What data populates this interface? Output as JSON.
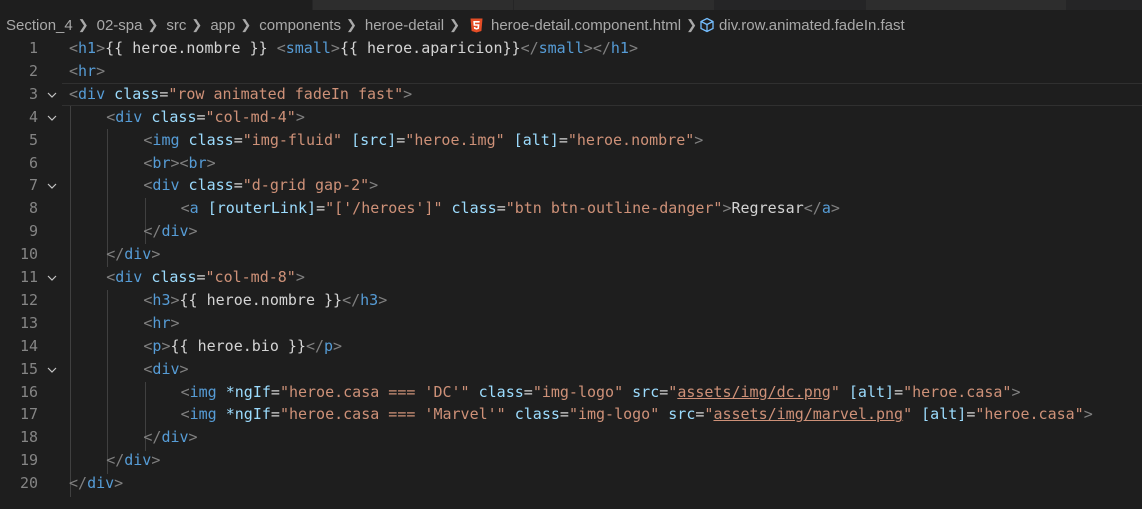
{
  "breadcrumb": {
    "items": [
      "Section_4",
      "02-spa",
      "src",
      "app",
      "components",
      "heroe-detail"
    ],
    "file": "heroe-detail.component.html",
    "symbol": "div.row.animated.fadeIn.fast"
  },
  "editor": {
    "current_line": 3,
    "lines": [
      {
        "n": "1",
        "fold": false,
        "indent": 0,
        "tokens": [
          {
            "t": "<",
            "c": "ptag"
          },
          {
            "t": "h1",
            "c": "tag"
          },
          {
            "t": ">",
            "c": "ptag"
          },
          {
            "t": "{{ heroe.nombre }} ",
            "c": "txt"
          },
          {
            "t": "<",
            "c": "ptag"
          },
          {
            "t": "small",
            "c": "tag"
          },
          {
            "t": ">",
            "c": "ptag"
          },
          {
            "t": "{{ heroe.aparicion}}",
            "c": "txt"
          },
          {
            "t": "</",
            "c": "ptag"
          },
          {
            "t": "small",
            "c": "tag"
          },
          {
            "t": ">",
            "c": "ptag"
          },
          {
            "t": "</",
            "c": "ptag"
          },
          {
            "t": "h1",
            "c": "tag"
          },
          {
            "t": ">",
            "c": "ptag"
          }
        ]
      },
      {
        "n": "2",
        "fold": false,
        "indent": 0,
        "tokens": [
          {
            "t": "<",
            "c": "ptag"
          },
          {
            "t": "hr",
            "c": "tag"
          },
          {
            "t": ">",
            "c": "ptag"
          }
        ]
      },
      {
        "n": "3",
        "fold": true,
        "indent": 0,
        "tokens": [
          {
            "t": "<",
            "c": "ptag"
          },
          {
            "t": "div",
            "c": "tag"
          },
          {
            "t": " ",
            "c": "txt"
          },
          {
            "t": "class",
            "c": "attr"
          },
          {
            "t": "=",
            "c": "txt"
          },
          {
            "t": "\"row animated fadeIn fast\"",
            "c": "str"
          },
          {
            "t": ">",
            "c": "ptag"
          }
        ]
      },
      {
        "n": "4",
        "fold": true,
        "indent": 1,
        "tokens": [
          {
            "t": "<",
            "c": "ptag"
          },
          {
            "t": "div",
            "c": "tag"
          },
          {
            "t": " ",
            "c": "txt"
          },
          {
            "t": "class",
            "c": "attr"
          },
          {
            "t": "=",
            "c": "txt"
          },
          {
            "t": "\"col-md-4\"",
            "c": "str"
          },
          {
            "t": ">",
            "c": "ptag"
          }
        ]
      },
      {
        "n": "5",
        "fold": false,
        "indent": 2,
        "tokens": [
          {
            "t": "<",
            "c": "ptag"
          },
          {
            "t": "img",
            "c": "tag"
          },
          {
            "t": " ",
            "c": "txt"
          },
          {
            "t": "class",
            "c": "attr"
          },
          {
            "t": "=",
            "c": "txt"
          },
          {
            "t": "\"img-fluid\"",
            "c": "str"
          },
          {
            "t": " ",
            "c": "txt"
          },
          {
            "t": "[src]",
            "c": "attr"
          },
          {
            "t": "=",
            "c": "txt"
          },
          {
            "t": "\"heroe.img\"",
            "c": "str"
          },
          {
            "t": " ",
            "c": "txt"
          },
          {
            "t": "[alt]",
            "c": "attr"
          },
          {
            "t": "=",
            "c": "txt"
          },
          {
            "t": "\"heroe.nombre\"",
            "c": "str"
          },
          {
            "t": ">",
            "c": "ptag"
          }
        ]
      },
      {
        "n": "6",
        "fold": false,
        "indent": 2,
        "tokens": [
          {
            "t": "<",
            "c": "ptag"
          },
          {
            "t": "br",
            "c": "tag"
          },
          {
            "t": ">",
            "c": "ptag"
          },
          {
            "t": "<",
            "c": "ptag"
          },
          {
            "t": "br",
            "c": "tag"
          },
          {
            "t": ">",
            "c": "ptag"
          }
        ]
      },
      {
        "n": "7",
        "fold": true,
        "indent": 2,
        "tokens": [
          {
            "t": "<",
            "c": "ptag"
          },
          {
            "t": "div",
            "c": "tag"
          },
          {
            "t": " ",
            "c": "txt"
          },
          {
            "t": "class",
            "c": "attr"
          },
          {
            "t": "=",
            "c": "txt"
          },
          {
            "t": "\"d-grid gap-2\"",
            "c": "str"
          },
          {
            "t": ">",
            "c": "ptag"
          }
        ]
      },
      {
        "n": "8",
        "fold": false,
        "indent": 3,
        "tokens": [
          {
            "t": "<",
            "c": "ptag"
          },
          {
            "t": "a",
            "c": "tag"
          },
          {
            "t": " ",
            "c": "txt"
          },
          {
            "t": "[routerLink]",
            "c": "attr"
          },
          {
            "t": "=",
            "c": "txt"
          },
          {
            "t": "\"['/heroes']\"",
            "c": "str"
          },
          {
            "t": " ",
            "c": "txt"
          },
          {
            "t": "class",
            "c": "attr"
          },
          {
            "t": "=",
            "c": "txt"
          },
          {
            "t": "\"btn btn-outline-danger\"",
            "c": "str"
          },
          {
            "t": ">",
            "c": "ptag"
          },
          {
            "t": "Regresar",
            "c": "txt"
          },
          {
            "t": "</",
            "c": "ptag"
          },
          {
            "t": "a",
            "c": "tag"
          },
          {
            "t": ">",
            "c": "ptag"
          }
        ]
      },
      {
        "n": "9",
        "fold": false,
        "indent": 2,
        "tokens": [
          {
            "t": "</",
            "c": "ptag"
          },
          {
            "t": "div",
            "c": "tag"
          },
          {
            "t": ">",
            "c": "ptag"
          }
        ]
      },
      {
        "n": "10",
        "fold": false,
        "indent": 1,
        "tokens": [
          {
            "t": "</",
            "c": "ptag"
          },
          {
            "t": "div",
            "c": "tag"
          },
          {
            "t": ">",
            "c": "ptag"
          }
        ]
      },
      {
        "n": "11",
        "fold": true,
        "indent": 1,
        "tokens": [
          {
            "t": "<",
            "c": "ptag"
          },
          {
            "t": "div",
            "c": "tag"
          },
          {
            "t": " ",
            "c": "txt"
          },
          {
            "t": "class",
            "c": "attr"
          },
          {
            "t": "=",
            "c": "txt"
          },
          {
            "t": "\"col-md-8\"",
            "c": "str"
          },
          {
            "t": ">",
            "c": "ptag"
          }
        ]
      },
      {
        "n": "12",
        "fold": false,
        "indent": 2,
        "tokens": [
          {
            "t": "<",
            "c": "ptag"
          },
          {
            "t": "h3",
            "c": "tag"
          },
          {
            "t": ">",
            "c": "ptag"
          },
          {
            "t": "{{ heroe.nombre }}",
            "c": "txt"
          },
          {
            "t": "</",
            "c": "ptag"
          },
          {
            "t": "h3",
            "c": "tag"
          },
          {
            "t": ">",
            "c": "ptag"
          }
        ]
      },
      {
        "n": "13",
        "fold": false,
        "indent": 2,
        "tokens": [
          {
            "t": "<",
            "c": "ptag"
          },
          {
            "t": "hr",
            "c": "tag"
          },
          {
            "t": ">",
            "c": "ptag"
          }
        ]
      },
      {
        "n": "14",
        "fold": false,
        "indent": 2,
        "tokens": [
          {
            "t": "<",
            "c": "ptag"
          },
          {
            "t": "p",
            "c": "tag"
          },
          {
            "t": ">",
            "c": "ptag"
          },
          {
            "t": "{{ heroe.bio }}",
            "c": "txt"
          },
          {
            "t": "</",
            "c": "ptag"
          },
          {
            "t": "p",
            "c": "tag"
          },
          {
            "t": ">",
            "c": "ptag"
          }
        ]
      },
      {
        "n": "15",
        "fold": true,
        "indent": 2,
        "tokens": [
          {
            "t": "<",
            "c": "ptag"
          },
          {
            "t": "div",
            "c": "tag"
          },
          {
            "t": ">",
            "c": "ptag"
          }
        ]
      },
      {
        "n": "16",
        "fold": false,
        "indent": 3,
        "tokens": [
          {
            "t": "<",
            "c": "ptag"
          },
          {
            "t": "img",
            "c": "tag"
          },
          {
            "t": " ",
            "c": "txt"
          },
          {
            "t": "*ngIf",
            "c": "attr"
          },
          {
            "t": "=",
            "c": "txt"
          },
          {
            "t": "\"heroe.casa === 'DC'\"",
            "c": "str"
          },
          {
            "t": " ",
            "c": "txt"
          },
          {
            "t": "class",
            "c": "attr"
          },
          {
            "t": "=",
            "c": "txt"
          },
          {
            "t": "\"img-logo\"",
            "c": "str"
          },
          {
            "t": " ",
            "c": "txt"
          },
          {
            "t": "src",
            "c": "attr"
          },
          {
            "t": "=",
            "c": "txt"
          },
          {
            "t": "\"",
            "c": "str"
          },
          {
            "t": "assets/img/dc.png",
            "c": "link"
          },
          {
            "t": "\"",
            "c": "str"
          },
          {
            "t": " ",
            "c": "txt"
          },
          {
            "t": "[alt]",
            "c": "attr"
          },
          {
            "t": "=",
            "c": "txt"
          },
          {
            "t": "\"heroe.casa\"",
            "c": "str"
          },
          {
            "t": ">",
            "c": "ptag"
          }
        ]
      },
      {
        "n": "17",
        "fold": false,
        "indent": 3,
        "tokens": [
          {
            "t": "<",
            "c": "ptag"
          },
          {
            "t": "img",
            "c": "tag"
          },
          {
            "t": " ",
            "c": "txt"
          },
          {
            "t": "*ngIf",
            "c": "attr"
          },
          {
            "t": "=",
            "c": "txt"
          },
          {
            "t": "\"heroe.casa === 'Marvel'\"",
            "c": "str"
          },
          {
            "t": " ",
            "c": "txt"
          },
          {
            "t": "class",
            "c": "attr"
          },
          {
            "t": "=",
            "c": "txt"
          },
          {
            "t": "\"img-logo\"",
            "c": "str"
          },
          {
            "t": " ",
            "c": "txt"
          },
          {
            "t": "src",
            "c": "attr"
          },
          {
            "t": "=",
            "c": "txt"
          },
          {
            "t": "\"",
            "c": "str"
          },
          {
            "t": "assets/img/marvel.png",
            "c": "link"
          },
          {
            "t": "\"",
            "c": "str"
          },
          {
            "t": " ",
            "c": "txt"
          },
          {
            "t": "[alt]",
            "c": "attr"
          },
          {
            "t": "=",
            "c": "txt"
          },
          {
            "t": "\"heroe.casa\"",
            "c": "str"
          },
          {
            "t": ">",
            "c": "ptag"
          }
        ]
      },
      {
        "n": "18",
        "fold": false,
        "indent": 2,
        "tokens": [
          {
            "t": "</",
            "c": "ptag"
          },
          {
            "t": "div",
            "c": "tag"
          },
          {
            "t": ">",
            "c": "ptag"
          }
        ]
      },
      {
        "n": "19",
        "fold": false,
        "indent": 1,
        "tokens": [
          {
            "t": "</",
            "c": "ptag"
          },
          {
            "t": "div",
            "c": "tag"
          },
          {
            "t": ">",
            "c": "ptag"
          }
        ]
      },
      {
        "n": "20",
        "fold": false,
        "indent": 0,
        "tokens": [
          {
            "t": "</",
            "c": "ptag"
          },
          {
            "t": "div",
            "c": "tag"
          },
          {
            "t": ">",
            "c": "ptag"
          }
        ]
      }
    ]
  },
  "colors": {
    "background": "#1e1e1e",
    "tag": "#569cd6",
    "attribute": "#9cdcfe",
    "string": "#ce9178",
    "text": "#d4d4d4",
    "line_number": "#858585",
    "html_icon": "#e44d26"
  }
}
